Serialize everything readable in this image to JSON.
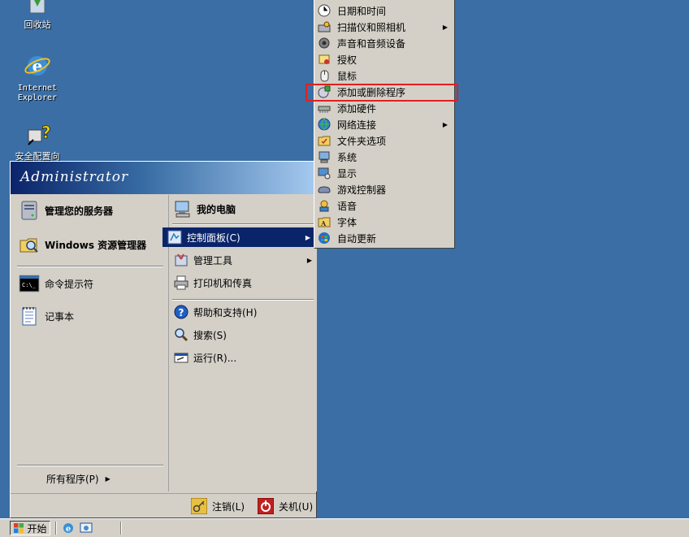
{
  "desktop": {
    "icons": [
      {
        "label": "回收站",
        "icon": "recycle-bin-icon"
      },
      {
        "label": "Internet\nExplorer",
        "icon": "internet-explorer-icon"
      },
      {
        "label": "安全配置向",
        "icon": "security-wizard-icon"
      }
    ]
  },
  "start_menu": {
    "user": "Administrator",
    "left": {
      "pinned": [
        {
          "label": "管理您的服务器",
          "icon": "server-icon"
        },
        {
          "label": "Windows 资源管理器",
          "icon": "folder-search-icon"
        }
      ],
      "recent": [
        {
          "label": "命令提示符",
          "icon": "command-prompt-icon"
        },
        {
          "label": "记事本",
          "icon": "notepad-icon"
        }
      ],
      "all_programs": "所有程序(P)"
    },
    "right": {
      "items": [
        {
          "label": "我的电脑",
          "icon": "computer-icon"
        },
        {
          "label": "控制面板(C)",
          "icon": "control-panel-icon"
        },
        {
          "label": "管理工具",
          "icon": "admin-tools-icon"
        },
        {
          "label": "打印机和传真",
          "icon": "printer-icon"
        },
        {
          "label": "帮助和支持(H)",
          "icon": "help-icon"
        },
        {
          "label": "搜索(S)",
          "icon": "search-icon"
        },
        {
          "label": "运行(R)...",
          "icon": "run-icon"
        }
      ]
    },
    "bottom": {
      "logoff": "注销(L)",
      "shutdown": "关机(U)"
    }
  },
  "control_panel_menu": {
    "items": [
      {
        "label": "日期和时间",
        "icon": "clock-icon"
      },
      {
        "label": "扫描仪和照相机",
        "icon": "scanner-icon"
      },
      {
        "label": "声音和音频设备",
        "icon": "speaker-icon"
      },
      {
        "label": "授权",
        "icon": "license-icon"
      },
      {
        "label": "鼠标",
        "icon": "mouse-icon"
      },
      {
        "label": "添加或删除程序",
        "icon": "add-remove-programs-icon"
      },
      {
        "label": "添加硬件",
        "icon": "hardware-icon"
      },
      {
        "label": "网络连接",
        "icon": "network-icon"
      },
      {
        "label": "文件夹选项",
        "icon": "folder-options-icon"
      },
      {
        "label": "系统",
        "icon": "system-icon"
      },
      {
        "label": "显示",
        "icon": "display-icon"
      },
      {
        "label": "游戏控制器",
        "icon": "gamepad-icon"
      },
      {
        "label": "语音",
        "icon": "speech-icon"
      },
      {
        "label": "字体",
        "icon": "fonts-icon"
      },
      {
        "label": "自动更新",
        "icon": "windows-update-icon"
      }
    ]
  },
  "taskbar": {
    "start_label": "开始"
  },
  "colors": {
    "desktop": "#3a6ea5",
    "menu_bg": "#d4d0c8",
    "selection": "#0a246a",
    "highlight_box": "#e02020"
  }
}
